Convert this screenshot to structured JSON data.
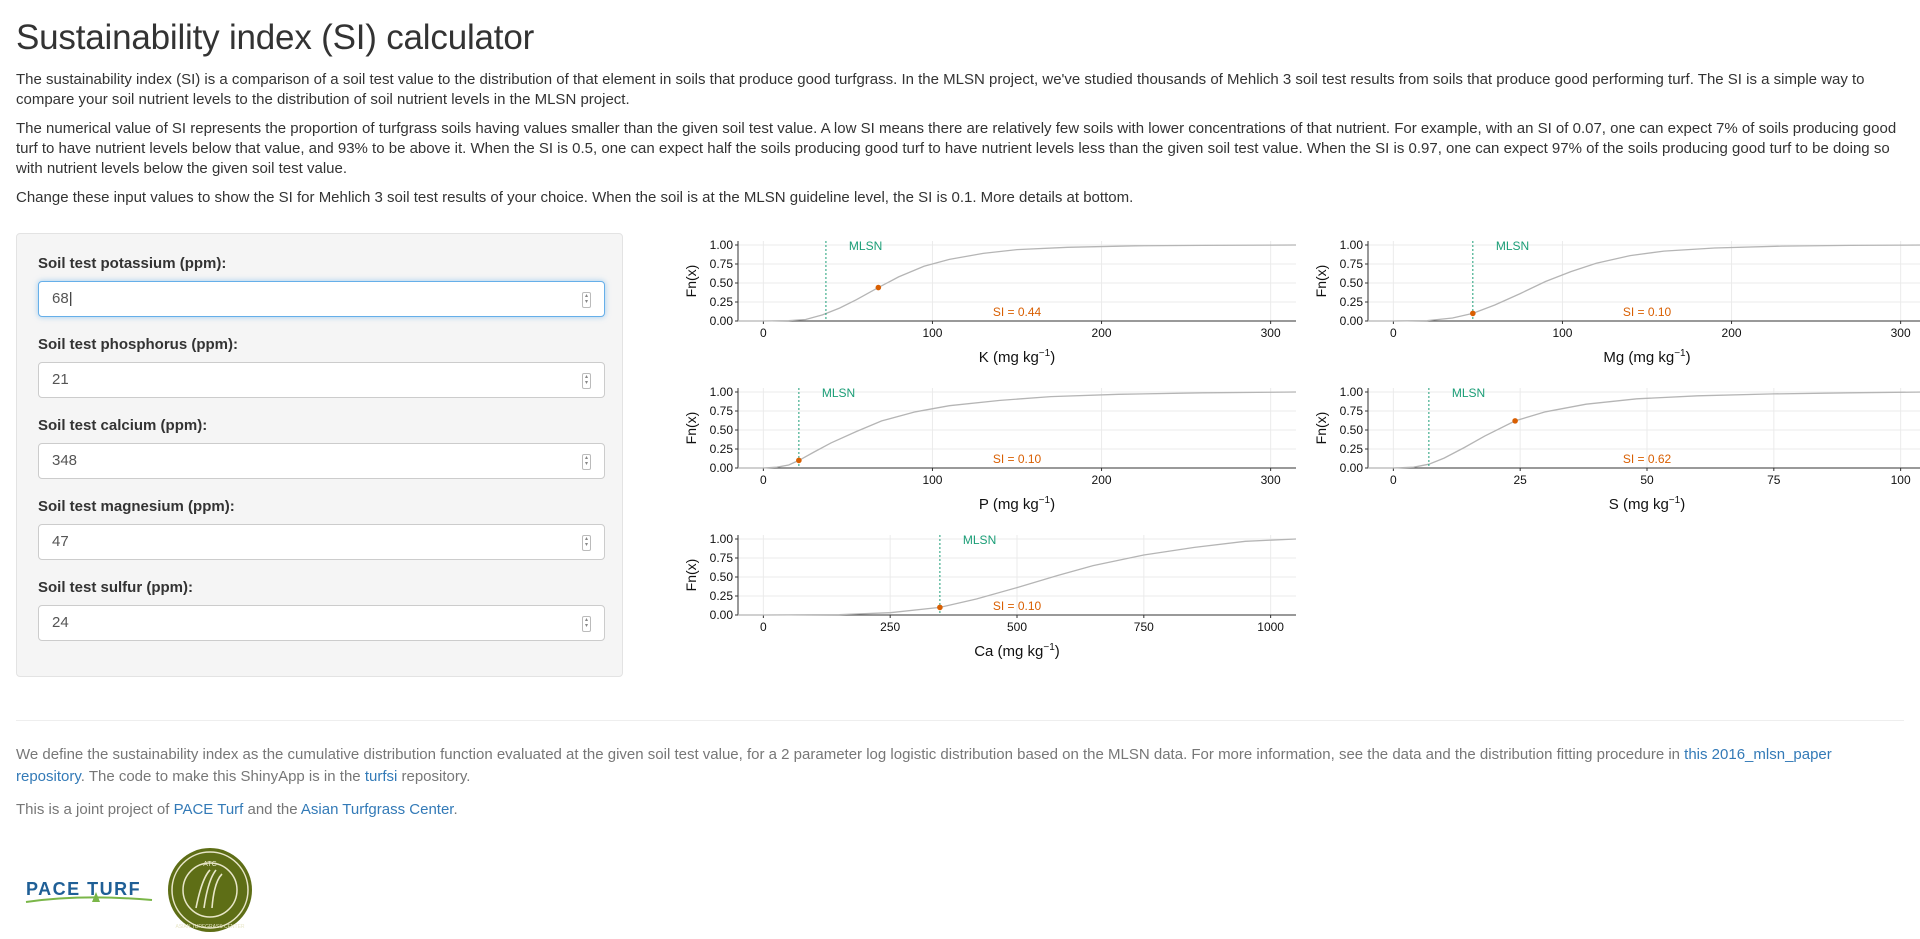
{
  "page": {
    "title": "Sustainability index (SI) calculator",
    "paragraphs": [
      "The sustainability index (SI) is a comparison of a soil test value to the distribution of that element in soils that produce good turfgrass. In the MLSN project, we've studied thousands of Mehlich 3 soil test results from soils that produce good performing turf. The SI is a simple way to compare your soil nutrient levels to the distribution of soil nutrient levels in the MLSN project.",
      "The numerical value of SI represents the proportion of turfgrass soils having values smaller than the given soil test value. A low SI means there are relatively few soils with lower concentrations of that nutrient. For example, with an SI of 0.07, one can expect 7% of soils producing good turf to have nutrient levels below that value, and 93% to be above it. When the SI is 0.5, one can expect half the soils producing good turf to have nutrient levels less than the given soil test value. When the SI is 0.97, one can expect 97% of the soils producing good turf to be doing so with nutrient levels below the given soil test value.",
      "Change these input values to show the SI for Mehlich 3 soil test results of your choice. When the soil is at the MLSN guideline level, the SI is 0.1. More details at bottom."
    ]
  },
  "inputs": {
    "potassium": {
      "label": "Soil test potassium (ppm):",
      "value": "68"
    },
    "phosphorus": {
      "label": "Soil test phosphorus (ppm):",
      "value": "21"
    },
    "calcium": {
      "label": "Soil test calcium (ppm):",
      "value": "348"
    },
    "magnesium": {
      "label": "Soil test magnesium (ppm):",
      "value": "47"
    },
    "sulfur": {
      "label": "Soil test sulfur (ppm):",
      "value": "24"
    }
  },
  "colors": {
    "curve": "#b5b5b5",
    "mlsn": "#1b9e77",
    "si": "#d95f02",
    "link": "#337ab7"
  },
  "chart_data": [
    {
      "type": "line",
      "element": "K",
      "xlabel": "K (mg kg",
      "xlabel_sup": "−1",
      "xlabel_end": ")",
      "ylabel": "Fn(x)",
      "xlim": [
        -15,
        315
      ],
      "xticks": [
        0,
        100,
        200,
        300
      ],
      "xtick_labels": [
        "0",
        "100",
        "200",
        "300"
      ],
      "ylim": [
        0,
        1
      ],
      "yticks": [
        0,
        0.25,
        0.5,
        0.75,
        1
      ],
      "ytick_labels": [
        "0.00",
        "0.25",
        "0.50",
        "0.75",
        "1.00"
      ],
      "mlsn": 37,
      "mlsn_label": "MLSN",
      "point": [
        68,
        0.44
      ],
      "si_label": "SI = 0.44",
      "curve": [
        [
          -15,
          0
        ],
        [
          0,
          0
        ],
        [
          15,
          0.005
        ],
        [
          25,
          0.02
        ],
        [
          35,
          0.08
        ],
        [
          45,
          0.17
        ],
        [
          55,
          0.28
        ],
        [
          68,
          0.44
        ],
        [
          80,
          0.58
        ],
        [
          95,
          0.72
        ],
        [
          110,
          0.81
        ],
        [
          130,
          0.89
        ],
        [
          150,
          0.94
        ],
        [
          180,
          0.97
        ],
        [
          220,
          0.99
        ],
        [
          260,
          0.995
        ],
        [
          315,
          1
        ]
      ]
    },
    {
      "type": "line",
      "element": "Mg",
      "xlabel": "Mg (mg kg",
      "xlabel_sup": "−1",
      "xlabel_end": ")",
      "ylabel": "Fn(x)",
      "xlim": [
        -15,
        315
      ],
      "xticks": [
        0,
        100,
        200,
        300
      ],
      "xtick_labels": [
        "0",
        "100",
        "200",
        "300"
      ],
      "ylim": [
        0,
        1
      ],
      "yticks": [
        0,
        0.25,
        0.5,
        0.75,
        1
      ],
      "ytick_labels": [
        "0.00",
        "0.25",
        "0.50",
        "0.75",
        "1.00"
      ],
      "mlsn": 47,
      "mlsn_label": "MLSN",
      "point": [
        47,
        0.1
      ],
      "si_label": "SI = 0.10",
      "curve": [
        [
          -15,
          0
        ],
        [
          0,
          0
        ],
        [
          20,
          0.005
        ],
        [
          35,
          0.04
        ],
        [
          47,
          0.1
        ],
        [
          60,
          0.21
        ],
        [
          75,
          0.36
        ],
        [
          90,
          0.52
        ],
        [
          105,
          0.65
        ],
        [
          120,
          0.76
        ],
        [
          140,
          0.86
        ],
        [
          160,
          0.92
        ],
        [
          190,
          0.96
        ],
        [
          230,
          0.985
        ],
        [
          270,
          0.995
        ],
        [
          315,
          1
        ]
      ]
    },
    {
      "type": "line",
      "element": "P",
      "xlabel": "P (mg kg",
      "xlabel_sup": "−1",
      "xlabel_end": ")",
      "ylabel": "Fn(x)",
      "xlim": [
        -15,
        315
      ],
      "xticks": [
        0,
        100,
        200,
        300
      ],
      "xtick_labels": [
        "0",
        "100",
        "200",
        "300"
      ],
      "ylim": [
        0,
        1
      ],
      "yticks": [
        0,
        0.25,
        0.5,
        0.75,
        1
      ],
      "ytick_labels": [
        "0.00",
        "0.25",
        "0.50",
        "0.75",
        "1.00"
      ],
      "mlsn": 21,
      "mlsn_label": "MLSN",
      "point": [
        21,
        0.1
      ],
      "si_label": "SI = 0.10",
      "curve": [
        [
          -15,
          0
        ],
        [
          0,
          0
        ],
        [
          8,
          0.01
        ],
        [
          15,
          0.04
        ],
        [
          21,
          0.1
        ],
        [
          30,
          0.21
        ],
        [
          40,
          0.33
        ],
        [
          55,
          0.48
        ],
        [
          70,
          0.62
        ],
        [
          90,
          0.74
        ],
        [
          110,
          0.82
        ],
        [
          140,
          0.89
        ],
        [
          170,
          0.94
        ],
        [
          210,
          0.97
        ],
        [
          260,
          0.99
        ],
        [
          315,
          1
        ]
      ]
    },
    {
      "type": "line",
      "element": "S",
      "xlabel": "S (mg kg",
      "xlabel_sup": "−1",
      "xlabel_end": ")",
      "ylabel": "Fn(x)",
      "xlim": [
        -5,
        105
      ],
      "xticks": [
        0,
        25,
        50,
        75,
        100
      ],
      "xtick_labels": [
        "0",
        "25",
        "50",
        "75",
        "100"
      ],
      "ylim": [
        0,
        1
      ],
      "yticks": [
        0,
        0.25,
        0.5,
        0.75,
        1
      ],
      "ytick_labels": [
        "0.00",
        "0.25",
        "0.50",
        "0.75",
        "1.00"
      ],
      "mlsn": 7,
      "mlsn_label": "MLSN",
      "point": [
        24,
        0.62
      ],
      "si_label": "SI = 0.62",
      "curve": [
        [
          -5,
          0
        ],
        [
          0,
          0
        ],
        [
          4,
          0.01
        ],
        [
          7,
          0.05
        ],
        [
          10,
          0.13
        ],
        [
          14,
          0.27
        ],
        [
          18,
          0.42
        ],
        [
          24,
          0.62
        ],
        [
          30,
          0.74
        ],
        [
          38,
          0.84
        ],
        [
          48,
          0.91
        ],
        [
          60,
          0.95
        ],
        [
          75,
          0.975
        ],
        [
          90,
          0.99
        ],
        [
          105,
          1
        ]
      ]
    },
    {
      "type": "line",
      "element": "Ca",
      "xlabel": "Ca (mg kg",
      "xlabel_sup": "−1",
      "xlabel_end": ")",
      "ylabel": "Fn(x)",
      "xlim": [
        -50,
        1050
      ],
      "xticks": [
        0,
        250,
        500,
        750,
        1000
      ],
      "xtick_labels": [
        "0",
        "250",
        "500",
        "750",
        "1000"
      ],
      "ylim": [
        0,
        1
      ],
      "yticks": [
        0,
        0.25,
        0.5,
        0.75,
        1
      ],
      "ytick_labels": [
        "0.00",
        "0.25",
        "0.50",
        "0.75",
        "1.00"
      ],
      "mlsn": 348,
      "mlsn_label": "MLSN",
      "point": [
        348,
        0.1
      ],
      "si_label": "SI = 0.10",
      "curve": [
        [
          -50,
          0
        ],
        [
          0,
          0
        ],
        [
          150,
          0.005
        ],
        [
          250,
          0.03
        ],
        [
          348,
          0.1
        ],
        [
          420,
          0.21
        ],
        [
          500,
          0.36
        ],
        [
          580,
          0.52
        ],
        [
          650,
          0.65
        ],
        [
          750,
          0.79
        ],
        [
          850,
          0.89
        ],
        [
          950,
          0.97
        ],
        [
          1050,
          1
        ]
      ]
    }
  ],
  "footer": {
    "p1_text": "We define the sustainability index as the cumulative distribution function evaluated at the given soil test value, for a 2 parameter log logistic distribution based on the MLSN data. For more information, see the data and the distribution fitting procedure in ",
    "p1_link1a": "this 2016_mlsn_paper",
    "p1_link1b": "repository",
    "p1_text2": ". The code to make this ShinyApp is in the ",
    "p1_link2": "turfsi",
    "p1_text3": " repository.",
    "p2_text": "This is a joint project of ",
    "p2_link1": "PACE Turf",
    "p2_text2": " and the ",
    "p2_link2": "Asian Turfgrass Center",
    "p2_text3": "."
  },
  "logos": {
    "pace": "PACE TURF",
    "atc_top": "ATC",
    "atc_ring": "ASIAN TURFGRASS CENTER"
  }
}
